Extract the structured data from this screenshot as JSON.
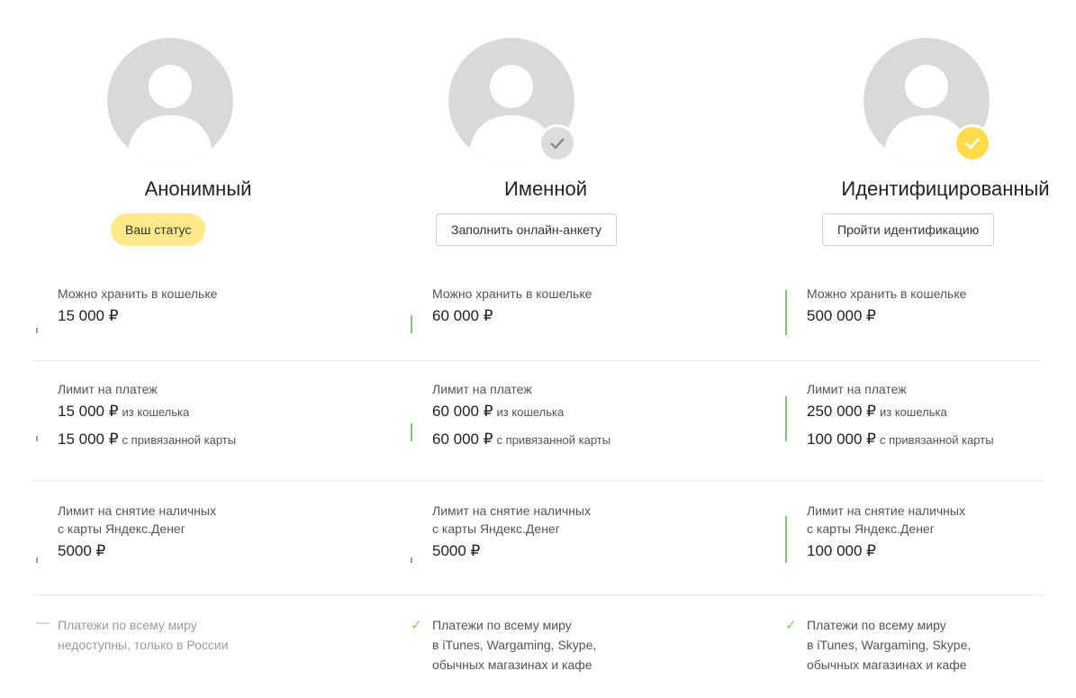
{
  "levels": [
    {
      "title": "Анонимный",
      "status_label": "Ваш статус",
      "storage_label": "Можно хранить в кошельке",
      "storage_value": "15 000 ₽",
      "payment_label": "Лимит на платеж",
      "payment_wallet_value": "15 000 ₽",
      "payment_wallet_suffix": "из кошелька",
      "payment_card_value": "15 000 ₽",
      "payment_card_suffix": "с привязанной карты",
      "cash_label_line1": "Лимит на снятие наличных",
      "cash_label_line2": "с карты Яндекс.Денег",
      "cash_value": "5000 ₽",
      "feature_line1": "Платежи по всему миру",
      "feature_line2": "недоступны, только в России",
      "feature_line3": ""
    },
    {
      "title": "Именной",
      "action_label": "Заполнить онлайн-анкету",
      "storage_label": "Можно хранить в кошельке",
      "storage_value": "60 000 ₽",
      "payment_label": "Лимит на платеж",
      "payment_wallet_value": "60 000 ₽",
      "payment_wallet_suffix": "из кошелька",
      "payment_card_value": "60 000 ₽",
      "payment_card_suffix": "с привязанной карты",
      "cash_label_line1": "Лимит на снятие наличных",
      "cash_label_line2": "с карты Яндекс.Денег",
      "cash_value": "5000 ₽",
      "feature_line1": "Платежи по всему миру",
      "feature_line2": "в iTunes, Wargaming, Skype,",
      "feature_line3": "обычных магазинах и кафе"
    },
    {
      "title": "Идентифицированный",
      "action_label": "Пройти идентификацию",
      "storage_label": "Можно хранить в кошельке",
      "storage_value": "500 000 ₽",
      "payment_label": "Лимит на платеж",
      "payment_wallet_value": "250 000 ₽",
      "payment_wallet_suffix": "из кошелька",
      "payment_card_value": "100 000 ₽",
      "payment_card_suffix": "с привязанной карты",
      "cash_label_line1": "Лимит на снятие наличных",
      "cash_label_line2": "с карты Яндекс.Денег",
      "cash_value": "100 000 ₽",
      "feature_line1": "Платежи по всему миру",
      "feature_line2": "в iTunes, Wargaming, Skype,",
      "feature_line3": "обычных магазинах и кафе"
    }
  ],
  "colors": {
    "avatar_bg": "#d9d9d9",
    "status_pill": "#ffe98a",
    "badge_yellow": "#ffdb4d",
    "green_accent": "#7fc96b"
  },
  "icons": {
    "level_0": "user-silhouette-icon",
    "level_1_badge": "check-grey-icon",
    "level_2_badge": "check-yellow-icon",
    "feature_unavailable": "dash-icon",
    "feature_available": "check-icon"
  }
}
